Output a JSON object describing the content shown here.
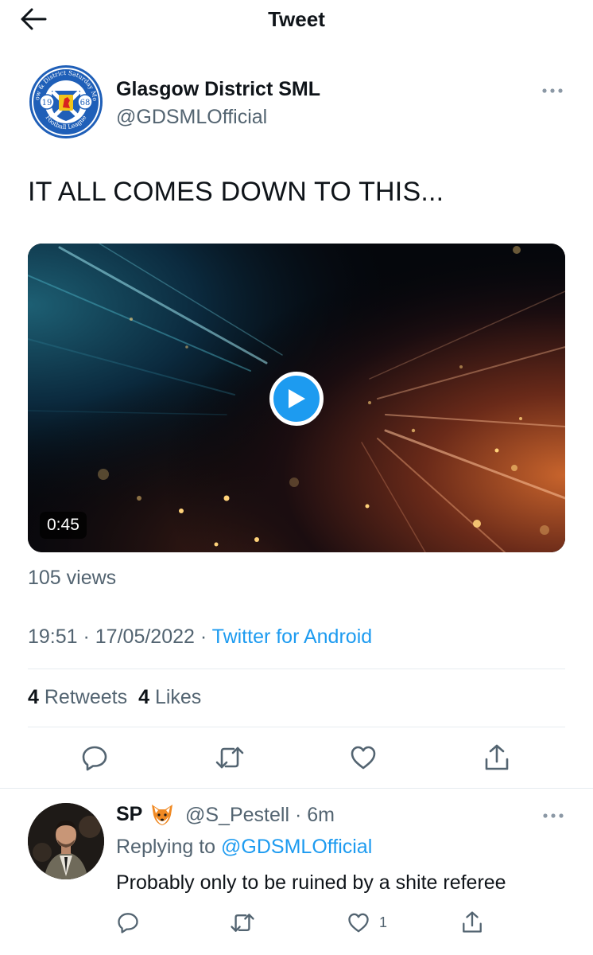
{
  "header": {
    "title": "Tweet",
    "back_icon": "arrow-left-icon"
  },
  "tweet": {
    "author_name": "Glasgow District SML",
    "author_handle": "@GDSMLOfficial",
    "text": "IT ALL COMES DOWN TO THIS...",
    "video_duration": "0:45",
    "views": "105 views",
    "time": "19:51",
    "date": "17/05/2022",
    "source": "Twitter for Android",
    "retweets_count": "4",
    "retweets_label": "Retweets",
    "likes_count": "4",
    "likes_label": "Likes",
    "logo": {
      "text_top": "Glasgow & District Saturday Morning",
      "text_bottom": "Football League",
      "year_left": "19",
      "year_right": "68"
    }
  },
  "reply": {
    "name": "SP",
    "emoji": "fox-emoji",
    "handle": "@S_Pestell",
    "age": "6m",
    "replying_prefix": "Replying to",
    "replying_to": "@GDSMLOfficial",
    "text": "Probably only to be ruined by a shite referee",
    "like_count": "1"
  },
  "colors": {
    "accent": "#1d9bf0",
    "secondary_text": "#536471",
    "primary_text": "#0f1419",
    "divider": "#e6ecf0",
    "logo_blue": "#1f5fb8"
  }
}
